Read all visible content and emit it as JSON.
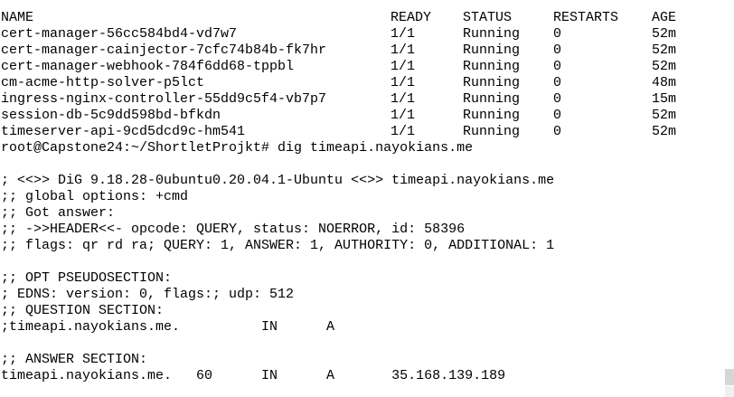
{
  "pods": {
    "headers": [
      "NAME",
      "READY",
      "STATUS",
      "RESTARTS",
      "AGE"
    ],
    "rows": [
      [
        "cert-manager-56cc584bd4-vd7w7",
        "1/1",
        "Running",
        "0",
        "52m"
      ],
      [
        "cert-manager-cainjector-7cfc74b84b-fk7hr",
        "1/1",
        "Running",
        "0",
        "52m"
      ],
      [
        "cert-manager-webhook-784f6dd68-tppbl",
        "1/1",
        "Running",
        "0",
        "52m"
      ],
      [
        "cm-acme-http-solver-p5lct",
        "1/1",
        "Running",
        "0",
        "48m"
      ],
      [
        "ingress-nginx-controller-55dd9c5f4-vb7p7",
        "1/1",
        "Running",
        "0",
        "15m"
      ],
      [
        "session-db-5c9dd598bd-bfkdn",
        "1/1",
        "Running",
        "0",
        "52m"
      ],
      [
        "timeserver-api-9cd5dcd9c-hm541",
        "1/1",
        "Running",
        "0",
        "52m"
      ]
    ]
  },
  "prompt": "root@Capstone24:~/ShortletProjkt# dig timeapi.nayokians.me",
  "dig_output": [
    "",
    "; <<>> DiG 9.18.28-0ubuntu0.20.04.1-Ubuntu <<>> timeapi.nayokians.me",
    ";; global options: +cmd",
    ";; Got answer:",
    ";; ->>HEADER<<- opcode: QUERY, status: NOERROR, id: 58396",
    ";; flags: qr rd ra; QUERY: 1, ANSWER: 1, AUTHORITY: 0, ADDITIONAL: 1",
    "",
    ";; OPT PSEUDOSECTION:",
    "; EDNS: version: 0, flags:; udp: 512",
    ";; QUESTION SECTION:",
    ";timeapi.nayokians.me.          IN      A",
    "",
    ";; ANSWER SECTION:",
    "timeapi.nayokians.me.   60      IN      A       35.168.139.189"
  ]
}
